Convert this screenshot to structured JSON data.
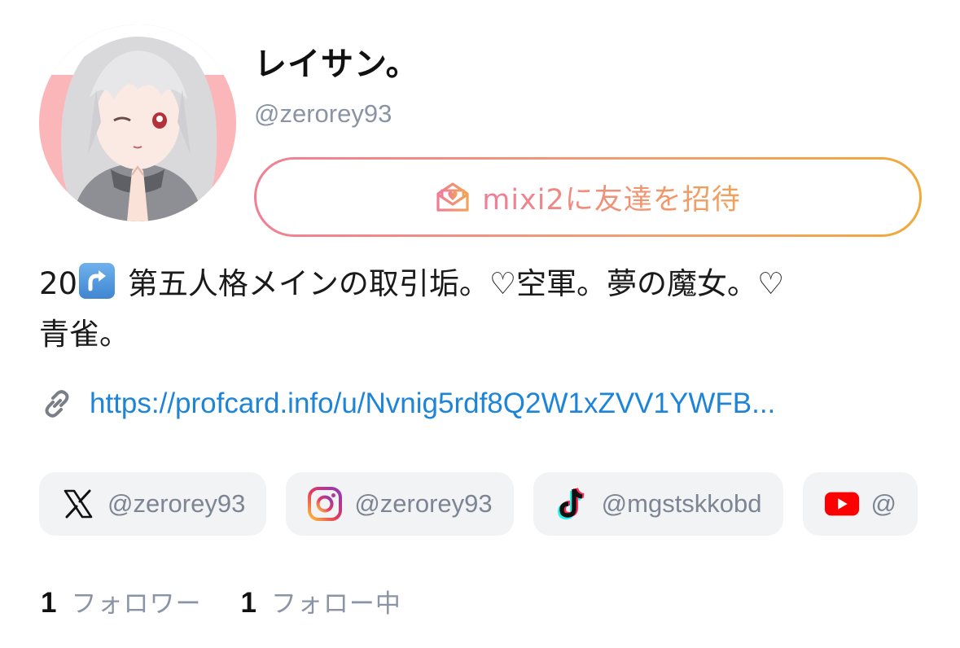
{
  "profile": {
    "display_name": "レイサン。",
    "handle": "@zerorey93",
    "bio_prefix": "20",
    "bio_emoji": "arrow-right-hook-emoji",
    "bio_line1": " 第五人格メインの取引垢。♡空軍。夢の魔女。♡",
    "bio_line2": "青雀。",
    "link_url": "https://profcard.info/u/Nvnig5rdf8Q2W1xZVV1YWFB..."
  },
  "invite_button": {
    "label": "mixi2に友達を招待",
    "icon": "envelope-heart-icon",
    "gradient_start": "#f07f95",
    "gradient_end": "#f0a93a"
  },
  "socials": [
    {
      "service": "x",
      "icon": "x-logo-icon",
      "label": "@zerorey93"
    },
    {
      "service": "instagram",
      "icon": "instagram-logo-icon",
      "label": "@zerorey93"
    },
    {
      "service": "tiktok",
      "icon": "tiktok-logo-icon",
      "label": "@mgstskkobd"
    },
    {
      "service": "youtube",
      "icon": "youtube-logo-icon",
      "label": "@"
    }
  ],
  "stats": {
    "followers_count": "1",
    "followers_label": "フォロワー",
    "following_count": "1",
    "following_label": "フォロー中"
  },
  "colors": {
    "link": "#1d84d8",
    "muted": "#8a94a6",
    "chip_bg": "#f2f3f5",
    "avatar_bg": "#fbb6b9"
  }
}
